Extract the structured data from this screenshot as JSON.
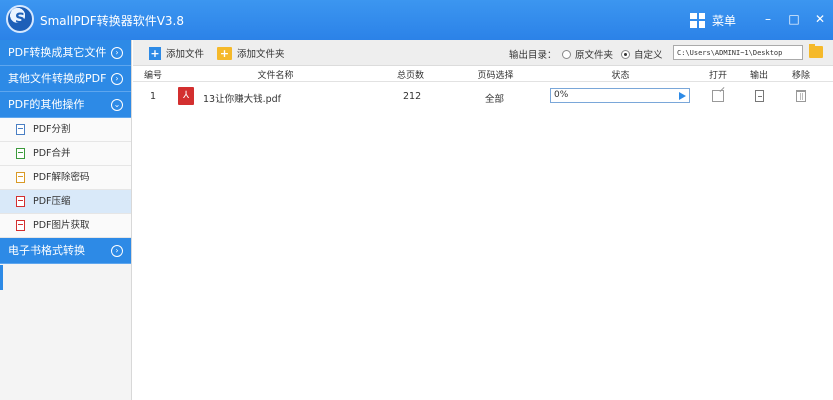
{
  "window": {
    "logo_letter": "S",
    "title": "SmallPDF转换器软件V3.8",
    "menu_label": "菜单",
    "minimize": "–",
    "maximize": "□",
    "close": "✕"
  },
  "sidebar": {
    "categories": [
      {
        "label": "PDF转换成其它文件",
        "expanded": false
      },
      {
        "label": "其他文件转换成PDF",
        "expanded": false
      },
      {
        "label": "PDF的其他操作",
        "expanded": true
      },
      {
        "label": "电子书格式转换",
        "expanded": false
      }
    ],
    "sub_items": [
      {
        "label": "PDF分割",
        "active": false,
        "icon_color": "#4a7fc4"
      },
      {
        "label": "PDF合并",
        "active": false,
        "icon_color": "#3c9a3c"
      },
      {
        "label": "PDF解除密码",
        "active": false,
        "icon_color": "#d99a26"
      },
      {
        "label": "PDF压缩",
        "active": true,
        "icon_color": "#d32f2f"
      },
      {
        "label": "PDF图片获取",
        "active": false,
        "icon_color": "#d32f2f"
      }
    ]
  },
  "toolbar": {
    "add_file": "添加文件",
    "add_folder": "添加文件夹",
    "output_label": "输出目录：",
    "radio_original": "原文件夹",
    "radio_custom": "自定义",
    "selected_output": "custom",
    "output_path": "C:\\Users\\ADMINI~1\\Desktop"
  },
  "table": {
    "headers": [
      "编号",
      "文件名称",
      "总页数",
      "页码选择",
      "状态",
      "打开",
      "输出",
      "移除"
    ],
    "rows": [
      {
        "index": "1",
        "filename": "13让你赚大钱.pdf",
        "pages": "212",
        "page_selection": "全部",
        "status_text": "0%",
        "progress": 0
      }
    ]
  },
  "colors": {
    "accent": "#2d8ae6",
    "title_bar": "#3c96f0",
    "pdf_red": "#d32f2f",
    "folder_yellow": "#f5b92a"
  }
}
